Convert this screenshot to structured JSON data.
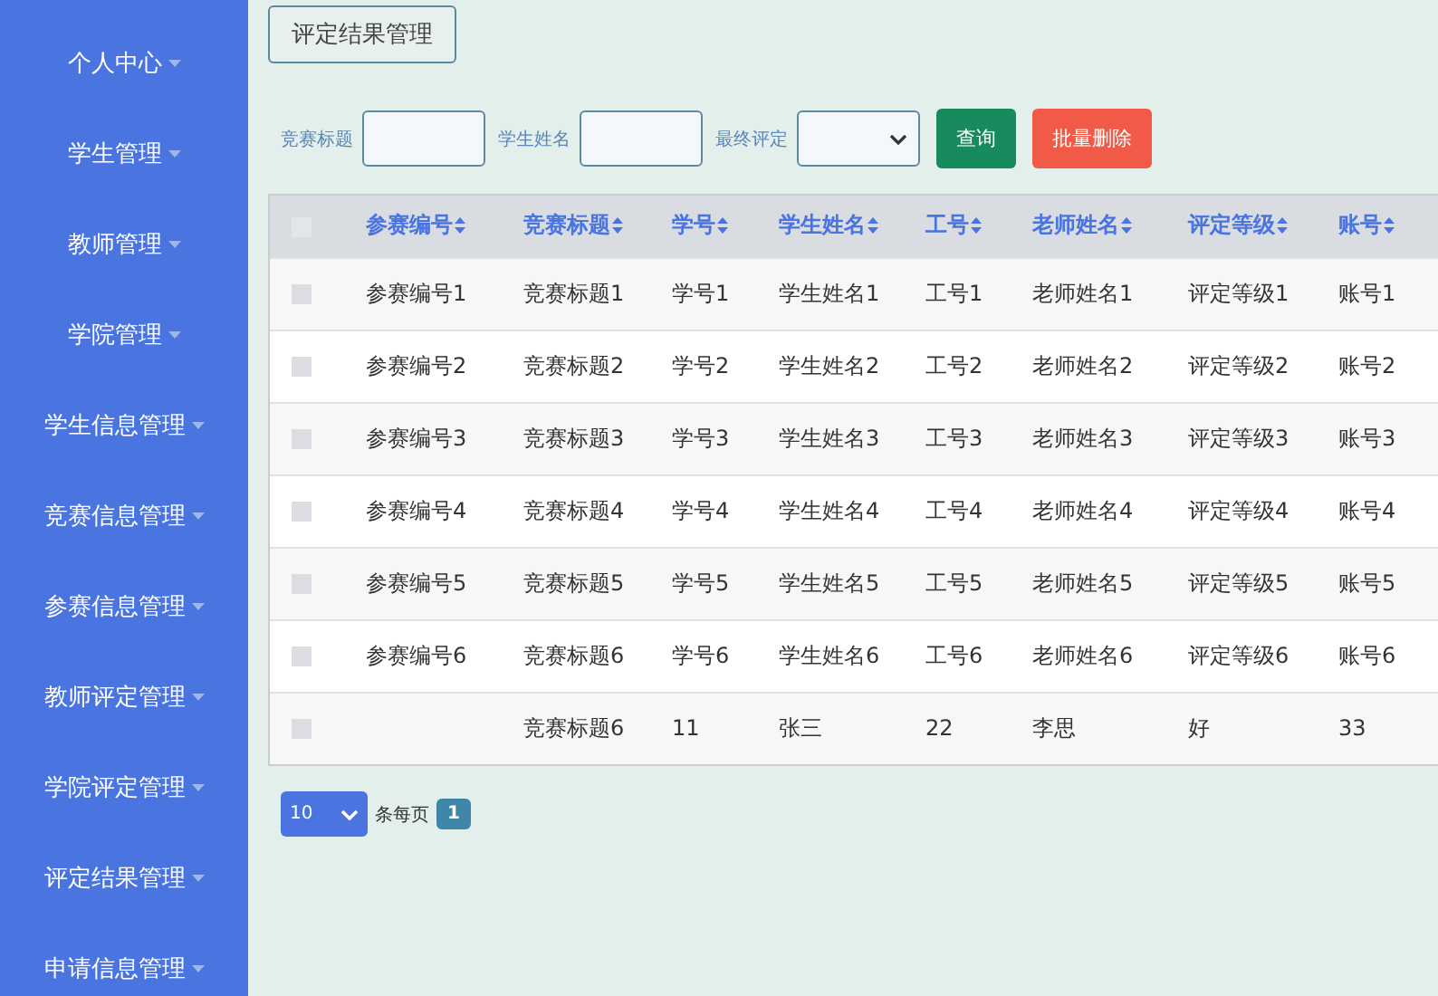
{
  "sidebar": {
    "items": [
      {
        "label": "个人中心"
      },
      {
        "label": "学生管理"
      },
      {
        "label": "教师管理"
      },
      {
        "label": "学院管理"
      },
      {
        "label": "学生信息管理"
      },
      {
        "label": "竞赛信息管理"
      },
      {
        "label": "参赛信息管理"
      },
      {
        "label": "教师评定管理"
      },
      {
        "label": "学院评定管理"
      },
      {
        "label": "评定结果管理"
      },
      {
        "label": "申请信息管理"
      }
    ]
  },
  "breadcrumb": "评定结果管理",
  "search": {
    "fields": [
      {
        "kind": "input",
        "label": "竞赛标题"
      },
      {
        "kind": "input",
        "label": "学生姓名"
      },
      {
        "kind": "select",
        "label": "最终评定"
      }
    ],
    "buttons": [
      {
        "kind": "query",
        "label": "查询"
      },
      {
        "kind": "delete",
        "label": "批量删除"
      }
    ]
  },
  "table": {
    "all_checked": false,
    "columns": [
      "参赛编号",
      "竞赛标题",
      "学号",
      "学生姓名",
      "工号",
      "老师姓名",
      "评定等级",
      "账号"
    ],
    "rows": [
      {
        "checked": false,
        "cells": [
          "参赛编号1",
          "竞赛标题1",
          "学号1",
          "学生姓名1",
          "工号1",
          "老师姓名1",
          "评定等级1",
          "账号1"
        ]
      },
      {
        "checked": false,
        "cells": [
          "参赛编号2",
          "竞赛标题2",
          "学号2",
          "学生姓名2",
          "工号2",
          "老师姓名2",
          "评定等级2",
          "账号2"
        ]
      },
      {
        "checked": false,
        "cells": [
          "参赛编号3",
          "竞赛标题3",
          "学号3",
          "学生姓名3",
          "工号3",
          "老师姓名3",
          "评定等级3",
          "账号3"
        ]
      },
      {
        "checked": false,
        "cells": [
          "参赛编号4",
          "竞赛标题4",
          "学号4",
          "学生姓名4",
          "工号4",
          "老师姓名4",
          "评定等级4",
          "账号4"
        ]
      },
      {
        "checked": false,
        "cells": [
          "参赛编号5",
          "竞赛标题5",
          "学号5",
          "学生姓名5",
          "工号5",
          "老师姓名5",
          "评定等级5",
          "账号5"
        ]
      },
      {
        "checked": false,
        "cells": [
          "参赛编号6",
          "竞赛标题6",
          "学号6",
          "学生姓名6",
          "工号6",
          "老师姓名6",
          "评定等级6",
          "账号6"
        ]
      },
      {
        "checked": false,
        "cells": [
          "",
          "竞赛标题6",
          "11",
          "张三",
          "22",
          "李思",
          "好",
          "33"
        ]
      }
    ]
  },
  "pagination": {
    "page_size": "10",
    "per_page_label": "条每页",
    "pages": [
      {
        "label": "1",
        "selected": true
      }
    ]
  }
}
